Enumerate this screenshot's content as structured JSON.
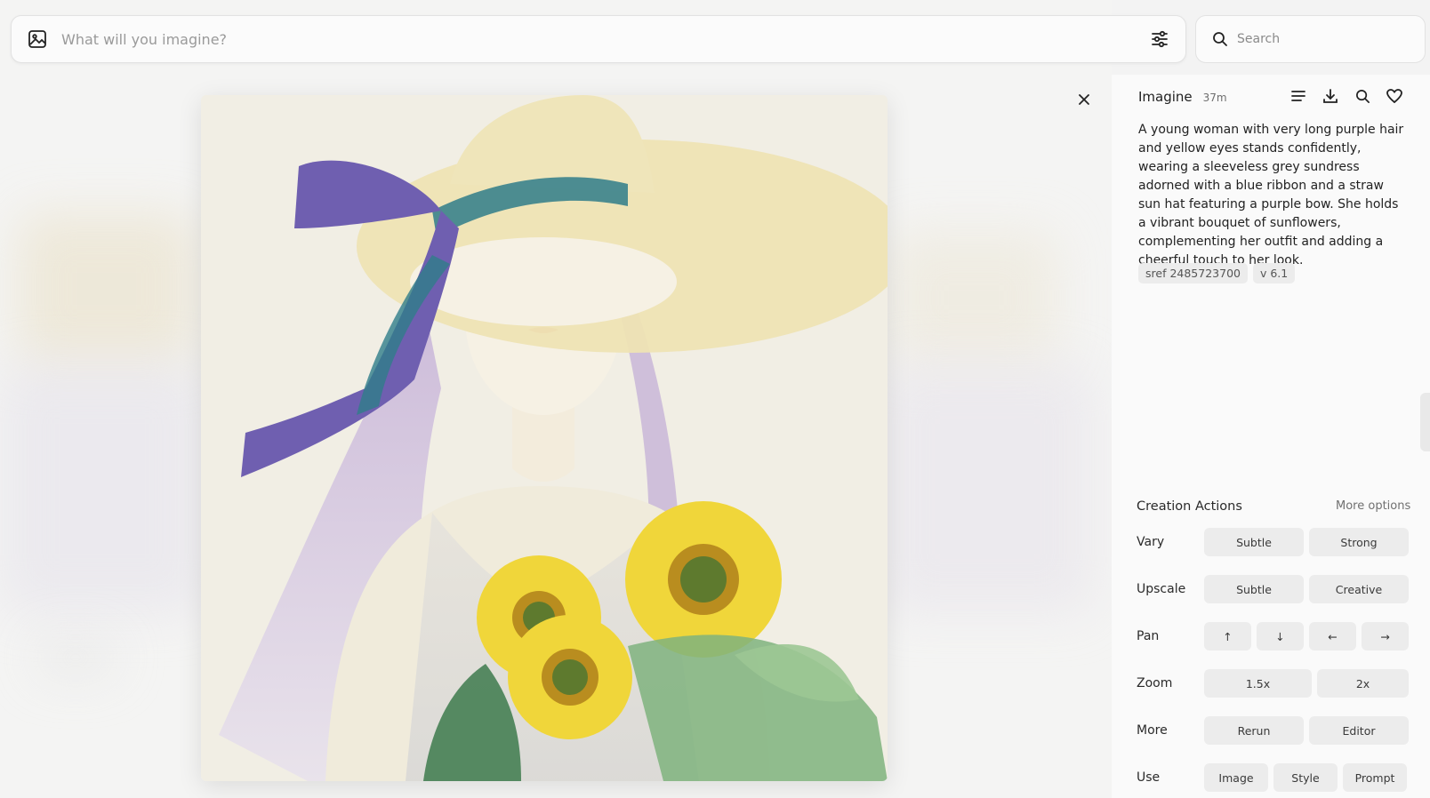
{
  "prompt_bar": {
    "placeholder": "What will you imagine?",
    "image_icon": "image-icon",
    "settings_icon": "sliders-icon"
  },
  "search": {
    "placeholder": "Search",
    "icon": "search-icon"
  },
  "panel": {
    "title": "Imagine",
    "time": "37m",
    "tools": [
      "menu-icon",
      "download-icon",
      "search-icon",
      "heart-icon"
    ],
    "description": "A young woman with very long purple hair and yellow eyes stands confidently, wearing a sleeveless grey sundress adorned with a blue ribbon and a straw sun hat featuring a purple bow. She holds a vibrant bouquet of sunflowers, complementing her outfit and adding a cheerful touch to her look.",
    "tags": [
      "sref 2485723700",
      "v 6.1"
    ]
  },
  "actions": {
    "title": "Creation Actions",
    "more_options": "More options",
    "rows": [
      {
        "label": "Vary",
        "buttons": [
          "Subtle",
          "Strong"
        ]
      },
      {
        "label": "Upscale",
        "buttons": [
          "Subtle",
          "Creative"
        ]
      },
      {
        "label": "Pan",
        "buttons": [
          "↑",
          "↓",
          "←",
          "→"
        ]
      },
      {
        "label": "Zoom",
        "buttons": [
          "1.5x",
          "2x"
        ]
      },
      {
        "label": "More",
        "buttons": [
          "Rerun",
          "Editor"
        ]
      },
      {
        "label": "Use",
        "buttons": [
          "Image",
          "Style",
          "Prompt"
        ]
      }
    ]
  },
  "colors": {
    "hat": "#eee3b4",
    "ribbon_purple": "#6f5fb0",
    "ribbon_teal": "#2f7d8a",
    "hair": "#b7a1cc",
    "sunflower": "#f0d63a",
    "leaf": "#7fb37e",
    "background": "#f1eee4"
  }
}
